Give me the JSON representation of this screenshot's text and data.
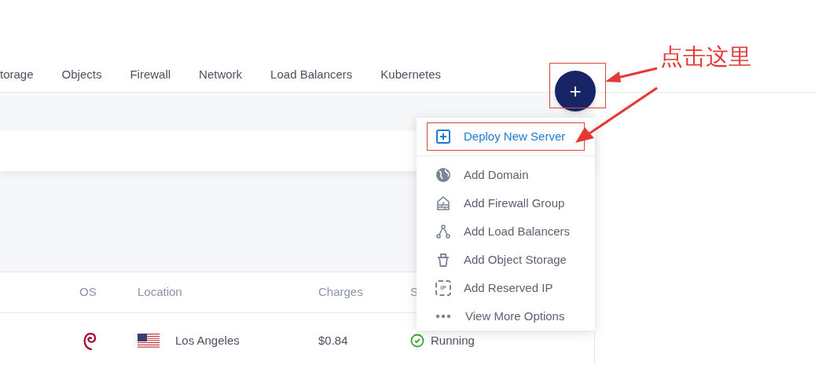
{
  "nav_tabs": [
    {
      "label": "torage",
      "selected": false
    },
    {
      "label": "Objects",
      "selected": false
    },
    {
      "label": "Firewall",
      "selected": false
    },
    {
      "label": "Network",
      "selected": false
    },
    {
      "label": "Load Balancers",
      "selected": false
    },
    {
      "label": "Kubernetes",
      "selected": false
    }
  ],
  "add_button": {
    "label": "+"
  },
  "menu": {
    "items": [
      {
        "label": "Deploy New Server",
        "kind": "primary",
        "highlighted": true
      },
      {
        "label": "Add Domain",
        "kind": "action",
        "highlighted": false
      },
      {
        "label": "Add Firewall Group",
        "kind": "action",
        "highlighted": false
      },
      {
        "label": "Add Load Balancers",
        "kind": "action",
        "highlighted": false
      },
      {
        "label": "Add Object Storage",
        "kind": "action",
        "highlighted": false
      },
      {
        "label": "Add Reserved IP",
        "kind": "action",
        "icon_text": "IP",
        "highlighted": false
      },
      {
        "label": "View More Options",
        "kind": "more",
        "highlighted": false
      }
    ]
  },
  "table": {
    "columns": [
      "OS",
      "Location",
      "Charges",
      "S"
    ],
    "rows": [
      {
        "location": "Los Angeles",
        "charges": "$0.84",
        "status": "Running"
      }
    ]
  },
  "annotation": {
    "text": "点击这里"
  }
}
